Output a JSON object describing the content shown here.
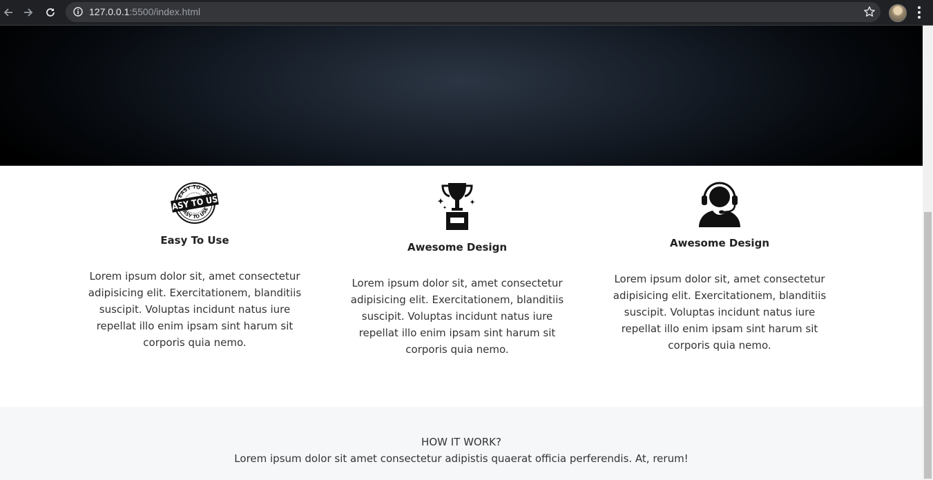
{
  "browser": {
    "url_host": "127.0.0.1",
    "url_path": ":5500/index.html",
    "icons": [
      "back-arrow-icon",
      "forward-arrow-icon",
      "reload-icon",
      "info-icon",
      "star-icon",
      "profile-avatar",
      "kebab-menu-icon"
    ]
  },
  "features": [
    {
      "icon": "easy-to-use-badge-icon",
      "title": "Easy To Use",
      "text": "Lorem ipsum dolor sit, amet consectetur adipisicing elit. Exercitationem, blanditiis suscipit. Voluptas incidunt natus iure repellat illo enim ipsam sint harum sit corporis quia nemo."
    },
    {
      "icon": "trophy-icon",
      "title": "Awesome Design",
      "text": "Lorem ipsum dolor sit, amet consectetur adipisicing elit. Exercitationem, blanditiis suscipit. Voluptas incidunt natus iure repellat illo enim ipsam sint harum sit corporis quia nemo."
    },
    {
      "icon": "headset-support-icon",
      "title": "Awesome Design",
      "text": "Lorem ipsum dolor sit, amet consectetur adipisicing elit. Exercitationem, blanditiis suscipit. Voluptas incidunt natus iure repellat illo enim ipsam sint harum sit corporis quia nemo."
    }
  ],
  "how": {
    "title": "HOW IT WORK?",
    "text": "Lorem ipsum dolor sit amet consectetur adipistis quaerat officia perferendis. At, rerum!"
  },
  "badge": {
    "top_arc": "EASY TO USE",
    "center": "EASY TO USE",
    "bottom_arc": "EASY TO USE"
  }
}
